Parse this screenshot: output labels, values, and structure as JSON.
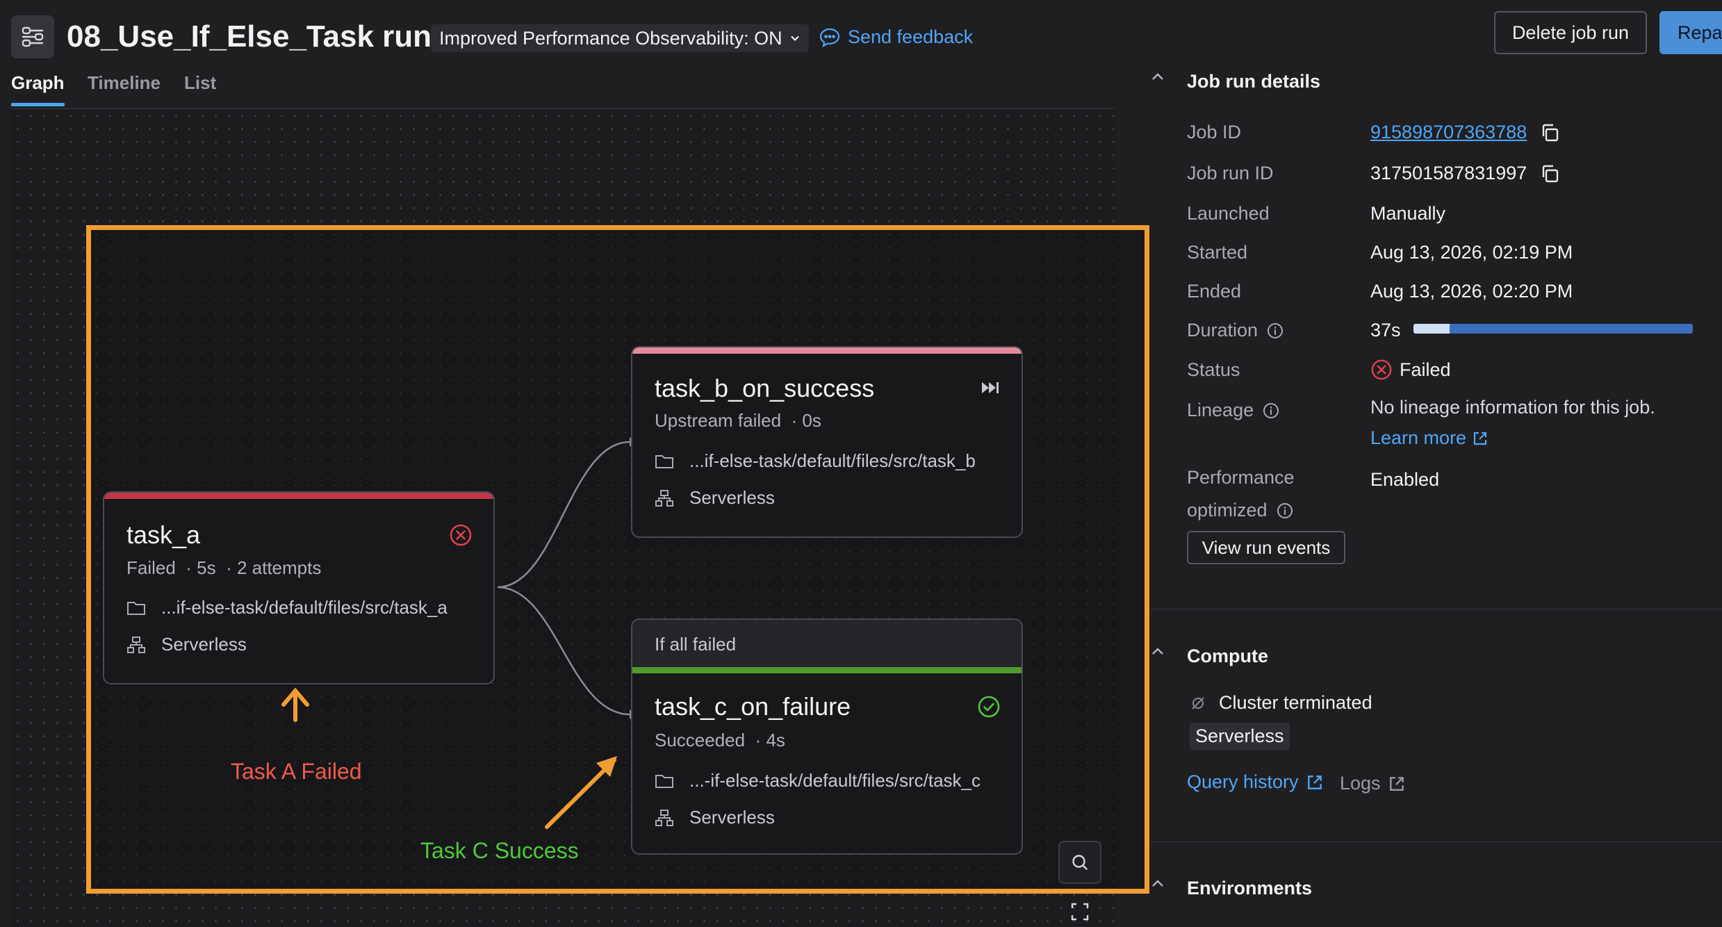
{
  "header": {
    "title": "08_Use_If_Else_Task run",
    "perf_toggle": "Improved Performance Observability: ON",
    "feedback": "Send feedback",
    "delete_button": "Delete job run",
    "repair_button": "Repai"
  },
  "tabs": [
    "Graph",
    "Timeline",
    "List"
  ],
  "graph": {
    "task_a": {
      "name": "task_a",
      "status": "Failed",
      "duration": "· 5s",
      "attempts": "· 2 attempts",
      "path": "...if-else-task/default/files/src/task_a",
      "compute": "Serverless",
      "bar_color": "#c23848"
    },
    "task_b": {
      "name": "task_b_on_success",
      "status": "Upstream failed",
      "duration": "· 0s",
      "path": "...if-else-task/default/files/src/task_b",
      "compute": "Serverless",
      "bar_color": "#e48a9c"
    },
    "task_c": {
      "condition": "If all failed",
      "name": "task_c_on_failure",
      "status": "Succeeded",
      "duration": "· 4s",
      "path": "...-if-else-task/default/files/src/task_c",
      "compute": "Serverless",
      "bar_color": "#4e9a2e"
    },
    "annotations": {
      "task_a": "Task A Failed",
      "task_c": "Task C Success"
    }
  },
  "details": {
    "section_title": "Job run details",
    "job_id_label": "Job ID",
    "job_id": "915898707363788",
    "run_id_label": "Job run ID",
    "run_id": "317501587831997",
    "launched_label": "Launched",
    "launched": "Manually",
    "started_label": "Started",
    "started": "Aug 13, 2026, 02:19 PM",
    "ended_label": "Ended",
    "ended": "Aug 13, 2026, 02:20 PM",
    "duration_label": "Duration",
    "duration": "37s",
    "duration_fraction": 0.13,
    "status_label": "Status",
    "status": "Failed",
    "lineage_label": "Lineage",
    "lineage_text": "No lineage information for this job.",
    "learn_more": "Learn more",
    "perf_label_1": "Performance",
    "perf_label_2": "optimized",
    "perf_value": "Enabled",
    "view_events": "View run events"
  },
  "compute": {
    "section_title": "Compute",
    "cluster_status": "Cluster terminated",
    "cluster_type": "Serverless",
    "query_history": "Query history",
    "logs": "Logs"
  },
  "environments": {
    "section_title": "Environments"
  },
  "colors": {
    "accent": "#4fa6f5",
    "highlight": "#f29d33",
    "failed": "#e0404f",
    "success": "#4fc93a"
  }
}
